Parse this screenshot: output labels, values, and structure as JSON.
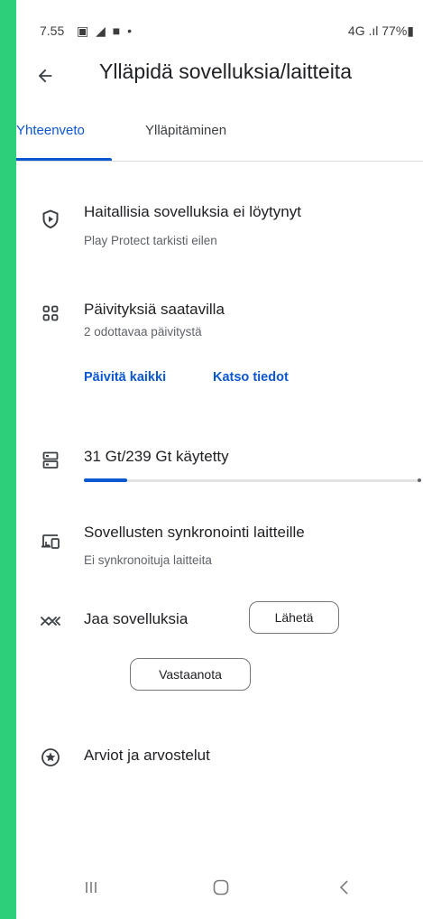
{
  "status_bar": {
    "time": "7.55",
    "notification_icons": "▣ ◢ ■ •",
    "right_text": "4G .ıl 77%▮"
  },
  "header": {
    "title": "Ylläpidä sovelluksia/laitteita",
    "back_icon": "arrow-left-icon"
  },
  "tabs": [
    {
      "label": "Yhteenveto",
      "active": true
    },
    {
      "label": "Ylläpitäminen",
      "active": false
    }
  ],
  "overview": {
    "protect": {
      "title": "Haitallisia sovelluksia ei löytynyt",
      "subtitle": "Play Protect tarkisti eilen",
      "icon": "play-protect-shield-icon"
    },
    "updates": {
      "title": "Päivityksiä saatavilla",
      "subtitle": "2 odottavaa päivitystä",
      "icon": "apps-grid-icon",
      "update_all_label": "Päivitä kaikki",
      "see_details_label": "Katso tiedot"
    },
    "storage": {
      "title": "31 Gt/239 Gt käytetty",
      "used_fraction": 0.13,
      "icon": "storage-icon"
    },
    "sync": {
      "title": "Sovellusten synkronointi laitteille",
      "subtitle": "Ei synkronoituja laitteita",
      "icon": "devices-icon"
    },
    "share": {
      "title": "Jaa sovelluksia",
      "send_label": "Lähetä",
      "receive_label": "Vastaanota",
      "icon": "nearby-share-icon"
    },
    "ratings": {
      "title": "Arviot ja arvostelut",
      "icon": "star-circle-icon"
    }
  },
  "colors": {
    "accent": "#0b57d0",
    "frame": "#2ecf7a"
  }
}
